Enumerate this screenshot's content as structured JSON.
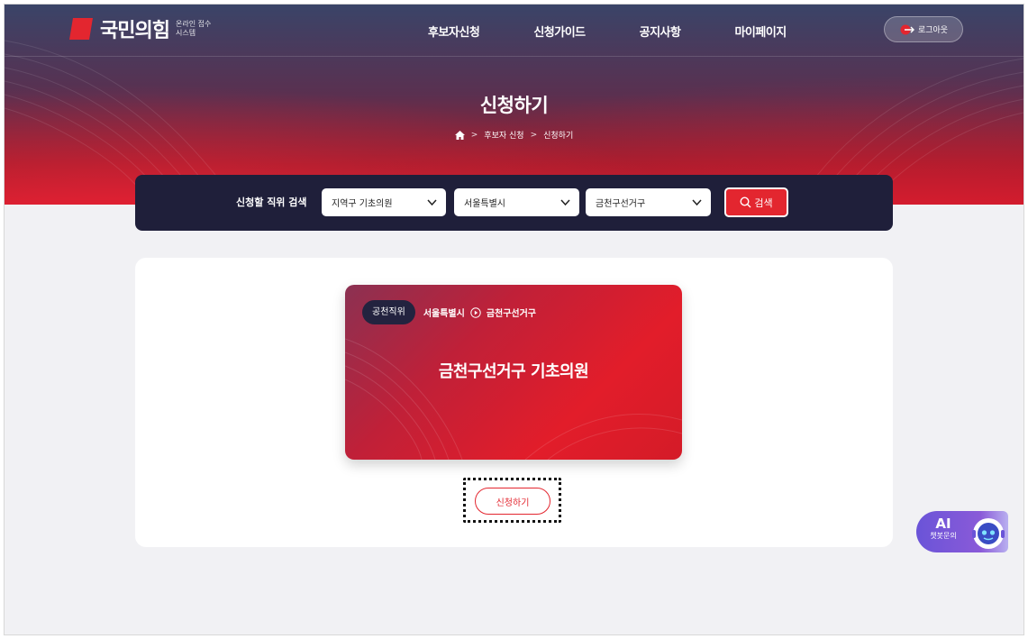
{
  "header": {
    "logo_text": "국민의힘",
    "logo_sub": "온라인 접수 시스템",
    "nav": [
      "후보자신청",
      "신청가이드",
      "공지사항",
      "마이페이지"
    ],
    "logout_label": "로그아웃"
  },
  "hero": {
    "title": "신청하기",
    "breadcrumb": [
      "후보자 신청",
      "신청하기"
    ]
  },
  "search": {
    "label": "신청할 직위 검색",
    "position": "지역구 기초의원",
    "city": "서울특별시",
    "district": "금천구선거구",
    "button_label": "검색"
  },
  "card": {
    "badge": "공천직위",
    "city": "서울특별시",
    "district": "금천구선거구",
    "title": "금천구선거구 기초의원"
  },
  "apply": {
    "label": "신청하기"
  },
  "chatbot": {
    "title": "AI",
    "subtitle": "챗봇문의"
  },
  "colors": {
    "accent": "#e3262f",
    "navy": "#1f1f3a",
    "chatbot": "#6a54d8"
  }
}
